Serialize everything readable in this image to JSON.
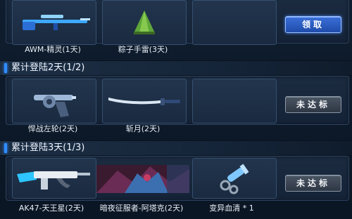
{
  "rows": [
    {
      "rewards": [
        {
          "name": "AWM-精灵(1天)",
          "icon": "sniper-rifle-icon"
        },
        {
          "name": "粽子手雷(3天)",
          "icon": "zongzi-grenade-icon"
        },
        {
          "name": "",
          "icon": "empty-slot"
        }
      ],
      "button": "领取",
      "button_state": "claimable"
    },
    {
      "header": "累计登陆2天(1/2)",
      "rewards": [
        {
          "name": "悍战左轮(2天)",
          "icon": "revolver-icon"
        },
        {
          "name": "斩月(2天)",
          "icon": "blade-icon"
        },
        {
          "name": "",
          "icon": "empty-slot"
        }
      ],
      "button": "未达标",
      "button_state": "locked"
    },
    {
      "header": "累计登陆3天(1/3)",
      "rewards": [
        {
          "name": "AK47-天王星(2天)",
          "icon": "assault-rifle-icon"
        },
        {
          "name": "暗夜征服者-阿塔克(2天)",
          "icon": "character-portrait"
        },
        {
          "name": "变异血清 * 1",
          "icon": "serum-syringe-icon"
        }
      ],
      "button": "未达标",
      "button_state": "locked"
    }
  ],
  "colors": {
    "accent": "#2f8dff",
    "claim_button": "#2a5cc4",
    "locked_button": "#3a4452"
  }
}
